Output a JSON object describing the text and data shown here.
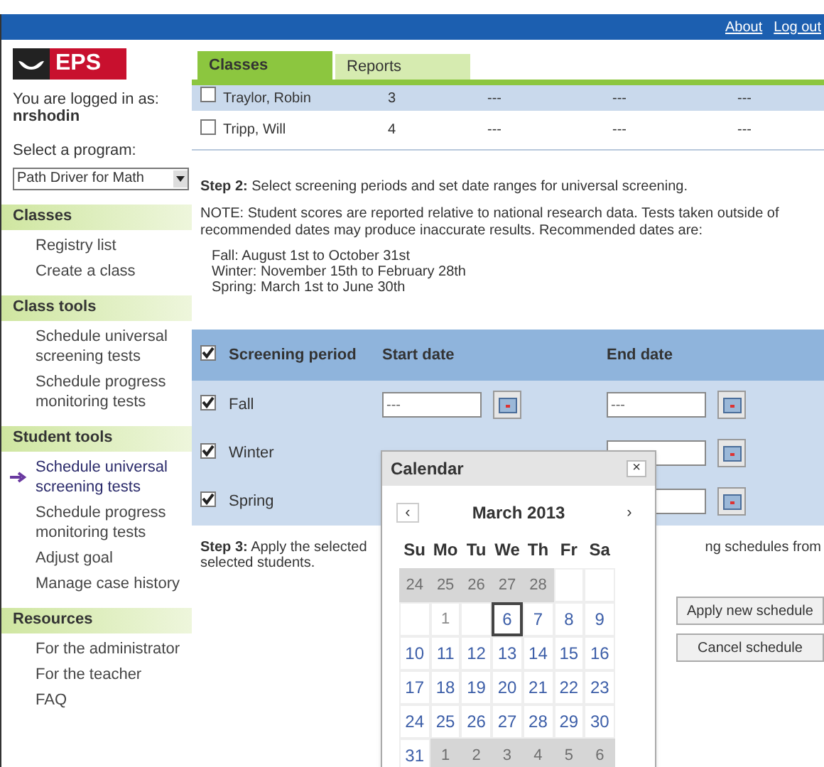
{
  "top_links": [
    "About",
    "Log out"
  ],
  "sidebar": {
    "logo": "EPS",
    "login_label": "You are logged in as:",
    "username": "nrshodin",
    "program_label": "Select a program:",
    "program": "Path Driver for Math",
    "sections": [
      {
        "title": "Classes",
        "items": [
          {
            "label": "Registry list",
            "selected": false
          },
          {
            "label": "Create a class",
            "selected": false
          }
        ]
      },
      {
        "title": "Class tools",
        "items": [
          {
            "label": "Schedule universal screening tests",
            "selected": false
          },
          {
            "label": "Schedule progress monitoring tests",
            "selected": false
          }
        ]
      },
      {
        "title": "Student tools",
        "items": [
          {
            "label": "Schedule universal screening tests",
            "selected": true
          },
          {
            "label": "Schedule progress monitoring tests",
            "selected": false
          },
          {
            "label": "Adjust goal",
            "selected": false
          },
          {
            "label": "Manage case history",
            "selected": false
          }
        ]
      },
      {
        "title": "Resources",
        "items": [
          {
            "label": "For the administrator",
            "selected": false
          },
          {
            "label": "For the teacher",
            "selected": false
          },
          {
            "label": "FAQ",
            "selected": false
          }
        ]
      }
    ]
  },
  "tabs": [
    {
      "label": "Classes",
      "selected": true
    },
    {
      "label": "Reports",
      "selected": false
    }
  ],
  "students": [
    {
      "name": "Traylor, Robin",
      "grade": "3",
      "column_3": "---",
      "column_4": "---",
      "column_5": "---",
      "checked": false,
      "highlighted": true
    },
    {
      "name": "Tripp, Will",
      "grade": "4",
      "column_3": "---",
      "column_4": "---",
      "column_5": "---",
      "checked": false,
      "highlighted": false
    }
  ],
  "step2": "**Step 2:** Select screening periods and set date ranges for universal screening.",
  "note": "NOTE: Student scores are reported relative to national research data. Tests taken outside of recommended dates may produce inaccurate results. Recommended dates are:",
  "recommended_dates": [
    "Fall: August 1st to October 31st",
    "Winter: November 15th to February 28th",
    "Spring: March 1st to June 30th"
  ],
  "periods_table": {
    "all_checked": true,
    "columns": [
      "Screening period",
      "Start date",
      "End date"
    ],
    "rows": [
      {
        "name": "Fall",
        "checked": true,
        "start_date": {
          "value": "---"
        },
        "end_date": {
          "value": "---"
        }
      },
      {
        "name": "Winter",
        "checked": true,
        "end_date": {}
      },
      {
        "name": "Spring",
        "checked": true,
        "end_date": {}
      }
    ]
  },
  "step3_left": [
    "**Step 3:** Apply the selected",
    "selected students."
  ],
  "step3_right": "ng schedules from",
  "buttons": [
    "Apply new schedule",
    "Cancel schedule"
  ],
  "calendar": {
    "title": "Calendar",
    "close": "×",
    "prev": "‹",
    "next": "›",
    "month": "March 2013",
    "weekdays": [
      "Su",
      "Mo",
      "Tu",
      "We",
      "Th",
      "Fr",
      "Sa"
    ],
    "days": [
      {
        "kind": "other",
        "text": "24"
      },
      {
        "kind": "other",
        "text": "25"
      },
      {
        "kind": "other",
        "text": "26"
      },
      {
        "kind": "other",
        "text": "27"
      },
      {
        "kind": "other",
        "text": "28"
      },
      {
        "kind": "empty"
      },
      {
        "kind": "empty"
      },
      {
        "kind": "empty"
      },
      {
        "kind": "disabled",
        "text": "1"
      },
      {
        "kind": "empty"
      },
      {
        "kind": "day",
        "text": "6",
        "selected": true
      },
      {
        "kind": "day",
        "text": "7",
        "selected": false
      },
      {
        "kind": "day",
        "text": "8",
        "selected": false
      },
      {
        "kind": "day",
        "text": "9",
        "selected": false
      },
      {
        "kind": "day",
        "text": "10",
        "selected": false
      },
      {
        "kind": "day",
        "text": "11",
        "selected": false
      },
      {
        "kind": "day",
        "text": "12",
        "selected": false
      },
      {
        "kind": "day",
        "text": "13",
        "selected": false
      },
      {
        "kind": "day",
        "text": "14",
        "selected": false
      },
      {
        "kind": "day",
        "text": "15",
        "selected": false
      },
      {
        "kind": "day",
        "text": "16",
        "selected": false
      },
      {
        "kind": "day",
        "text": "17",
        "selected": false
      },
      {
        "kind": "day",
        "text": "18",
        "selected": false
      },
      {
        "kind": "day",
        "text": "19",
        "selected": false
      },
      {
        "kind": "day",
        "text": "20",
        "selected": false
      },
      {
        "kind": "day",
        "text": "21",
        "selected": false
      },
      {
        "kind": "day",
        "text": "22",
        "selected": false
      },
      {
        "kind": "day",
        "text": "23",
        "selected": false
      },
      {
        "kind": "day",
        "text": "24",
        "selected": false
      },
      {
        "kind": "day",
        "text": "25",
        "selected": false
      },
      {
        "kind": "day",
        "text": "26",
        "selected": false
      },
      {
        "kind": "day",
        "text": "27",
        "selected": false
      },
      {
        "kind": "day",
        "text": "28",
        "selected": false
      },
      {
        "kind": "day",
        "text": "29",
        "selected": false
      },
      {
        "kind": "day",
        "text": "30",
        "selected": false
      },
      {
        "kind": "day",
        "text": "31",
        "selected": false
      },
      {
        "kind": "other",
        "text": "1"
      },
      {
        "kind": "other",
        "text": "2"
      },
      {
        "kind": "other",
        "text": "3"
      },
      {
        "kind": "other",
        "text": "4"
      },
      {
        "kind": "other",
        "text": "5"
      },
      {
        "kind": "other",
        "text": "6"
      }
    ]
  }
}
